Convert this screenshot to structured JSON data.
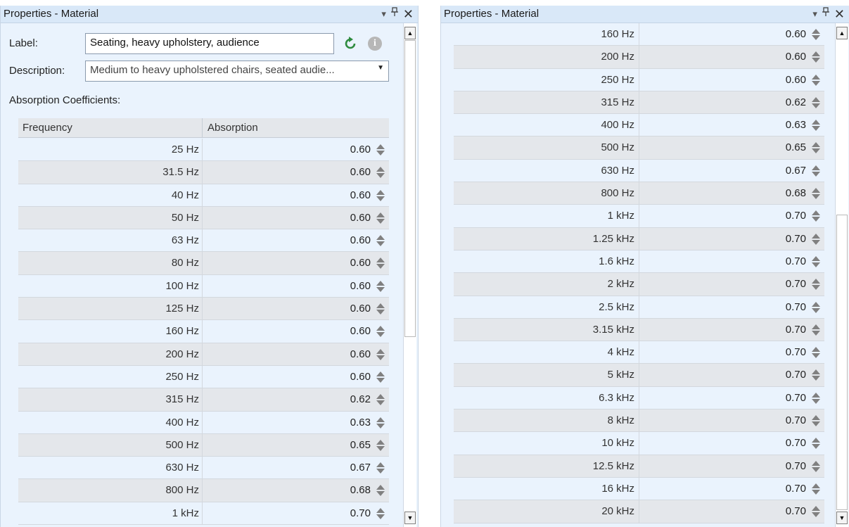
{
  "left_panel": {
    "title": "Properties - Material",
    "label_caption": "Label:",
    "label_value": "Seating, heavy upholstery, audience",
    "description_caption": "Description:",
    "description_value": "Medium to heavy upholstered chairs, seated audie...",
    "section_title": "Absorption Coefficients:",
    "col_frequency": "Frequency",
    "col_absorption": "Absorption",
    "rows": [
      {
        "freq": "25 Hz",
        "abs": "0.60"
      },
      {
        "freq": "31.5 Hz",
        "abs": "0.60"
      },
      {
        "freq": "40 Hz",
        "abs": "0.60"
      },
      {
        "freq": "50 Hz",
        "abs": "0.60"
      },
      {
        "freq": "63 Hz",
        "abs": "0.60"
      },
      {
        "freq": "80 Hz",
        "abs": "0.60"
      },
      {
        "freq": "100 Hz",
        "abs": "0.60"
      },
      {
        "freq": "125 Hz",
        "abs": "0.60"
      },
      {
        "freq": "160 Hz",
        "abs": "0.60"
      },
      {
        "freq": "200 Hz",
        "abs": "0.60"
      },
      {
        "freq": "250 Hz",
        "abs": "0.60"
      },
      {
        "freq": "315 Hz",
        "abs": "0.62"
      },
      {
        "freq": "400 Hz",
        "abs": "0.63"
      },
      {
        "freq": "500 Hz",
        "abs": "0.65"
      },
      {
        "freq": "630 Hz",
        "abs": "0.67"
      },
      {
        "freq": "800 Hz",
        "abs": "0.68"
      },
      {
        "freq": "1 kHz",
        "abs": "0.70"
      }
    ]
  },
  "right_panel": {
    "title": "Properties - Material",
    "rows": [
      {
        "freq": "160 Hz",
        "abs": "0.60"
      },
      {
        "freq": "200 Hz",
        "abs": "0.60"
      },
      {
        "freq": "250 Hz",
        "abs": "0.60"
      },
      {
        "freq": "315 Hz",
        "abs": "0.62"
      },
      {
        "freq": "400 Hz",
        "abs": "0.63"
      },
      {
        "freq": "500 Hz",
        "abs": "0.65"
      },
      {
        "freq": "630 Hz",
        "abs": "0.67"
      },
      {
        "freq": "800 Hz",
        "abs": "0.68"
      },
      {
        "freq": "1 kHz",
        "abs": "0.70"
      },
      {
        "freq": "1.25 kHz",
        "abs": "0.70"
      },
      {
        "freq": "1.6 kHz",
        "abs": "0.70"
      },
      {
        "freq": "2 kHz",
        "abs": "0.70"
      },
      {
        "freq": "2.5 kHz",
        "abs": "0.70"
      },
      {
        "freq": "3.15 kHz",
        "abs": "0.70"
      },
      {
        "freq": "4 kHz",
        "abs": "0.70"
      },
      {
        "freq": "5 kHz",
        "abs": "0.70"
      },
      {
        "freq": "6.3 kHz",
        "abs": "0.70"
      },
      {
        "freq": "8 kHz",
        "abs": "0.70"
      },
      {
        "freq": "10 kHz",
        "abs": "0.70"
      },
      {
        "freq": "12.5 kHz",
        "abs": "0.70"
      },
      {
        "freq": "16 kHz",
        "abs": "0.70"
      },
      {
        "freq": "20 kHz",
        "abs": "0.70"
      }
    ]
  },
  "icons": {
    "dropdown": "chevron-down-icon",
    "pin": "pin-icon",
    "close": "close-icon",
    "reset": "reset-icon",
    "info": "info-icon",
    "spinner": "spinner-icon"
  },
  "colors": {
    "panel_bg": "#eaf3fd",
    "titlebar_bg": "#d9e8f8",
    "row_alt_bg": "#e4e7eb",
    "reset_green": "#2e8b3e",
    "info_gray": "#b7b7b7"
  }
}
